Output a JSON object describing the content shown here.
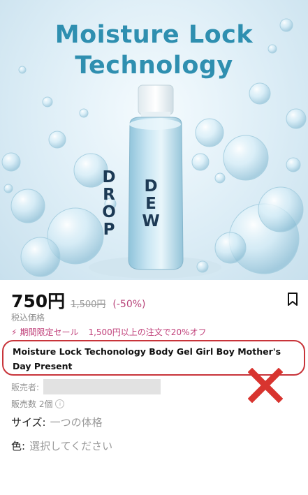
{
  "hero": {
    "title_line1": "Moisture Lock",
    "title_line2": "Technology",
    "bottle_label": "DEW DROP"
  },
  "pricing": {
    "price": "750円",
    "original_price": "1,500円",
    "discount": "(-50%)",
    "tax_label": "税込価格"
  },
  "promo": {
    "badge": "期間限定セール",
    "detail": "1,500円以上の注文で20%オフ"
  },
  "product": {
    "title": "Moisture Lock Techonology Body Gel Girl Boy  Mother's Day Present"
  },
  "seller": {
    "label": "販売者:"
  },
  "sales": {
    "label": "販売数 2個"
  },
  "options": {
    "size_label": "サイズ:",
    "size_value": "一つの体格",
    "color_label": "色:",
    "color_value": "選択してください"
  },
  "colors": {
    "accent_pink": "#c0407a",
    "annotation_red": "#c8343a",
    "hero_title": "#2f8fb0"
  },
  "icons": {
    "bookmark": "bookmark-icon",
    "bolt": "lightning-icon",
    "info": "info-icon",
    "x": "x-mark-icon"
  }
}
